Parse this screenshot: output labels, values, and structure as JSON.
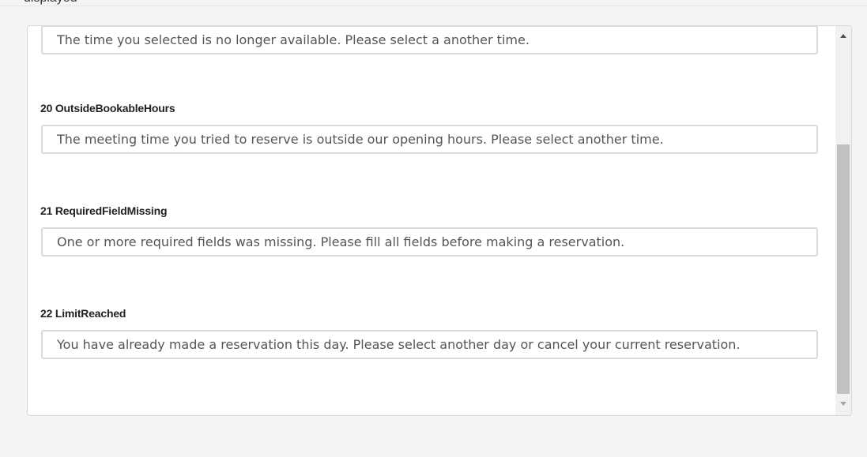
{
  "header": {
    "partial_text": "displayed"
  },
  "fields": [
    {
      "label": "",
      "value": "The time you selected is no longer available. Please select a another time."
    },
    {
      "label": "20 OutsideBookableHours",
      "value": "The meeting time you tried to reserve is outside our opening hours. Please select another time."
    },
    {
      "label": "21 RequiredFieldMissing",
      "value": "One or more required fields was missing. Please fill all fields before making a reservation."
    },
    {
      "label": "22 LimitReached",
      "value": "You have already made a reservation this day. Please select another day or cancel your current reservation."
    }
  ],
  "scrollbar": {
    "position": 0.55
  }
}
